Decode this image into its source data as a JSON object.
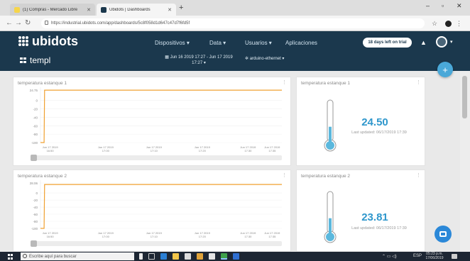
{
  "browser": {
    "tabs": [
      {
        "label": "(1) Compras - Mercado Libre",
        "favicon_color": "#f6d54a"
      },
      {
        "label": "Ubidots | Dashboards",
        "favicon_color": "#1b384d"
      }
    ],
    "new_tab": "+",
    "address": "https://industrial.ubidots.com/app/dashboards/5c8f058d1d647c47d7f6fd5f",
    "window_controls": {
      "minimize": "–",
      "maximize": "▫",
      "close": "✕"
    }
  },
  "app": {
    "logo_text": "ubidots",
    "nav": [
      {
        "label": "Dispositivos ▾"
      },
      {
        "label": "Data ▾"
      },
      {
        "label": "Usuarios ▾"
      },
      {
        "label": "Aplicaciones"
      }
    ],
    "trial_badge": "18 days left on trial",
    "dashboard_name": "templ",
    "date_range": "Jun 16 2019 17:27 - Jun 17 2019 17:27 ▾",
    "device_filter": "arduino-ethernet ▾",
    "fab": "+"
  },
  "widgets": {
    "chart1": {
      "title": "temperatura estanque 1",
      "menu": "⋮",
      "y_ticks": [
        "24.75",
        "0",
        "-20",
        "-40",
        "-60",
        "-80",
        "-100"
      ],
      "x_ticks": [
        [
          "Jun 17 2019",
          "16:50"
        ],
        [
          "Jun 17 2019",
          "17:00"
        ],
        [
          "Jun 17 2019",
          "17:10"
        ],
        [
          "Jun 17 2019",
          "17:20"
        ],
        [
          "Jun 17 2019",
          "17:30"
        ],
        [
          "Jun 17 2019",
          "17:35"
        ]
      ]
    },
    "gauge1": {
      "title": "temperatura estanque 1",
      "menu": "⋮",
      "value": "24.50",
      "updated": "Last updated: 06/17/2019 17:39",
      "fill_fraction": 0.35
    },
    "chart2": {
      "title": "temperatura estanque 2",
      "menu": "⋮",
      "y_ticks": [
        "28.06",
        "0",
        "-20",
        "-40",
        "-60",
        "-80",
        "-100"
      ],
      "x_ticks": [
        [
          "Jun 17 2019",
          "16:50"
        ],
        [
          "Jun 17 2019",
          "17:00"
        ],
        [
          "Jun 17 2019",
          "17:10"
        ],
        [
          "Jun 17 2019",
          "17:20"
        ],
        [
          "Jun 17 2019",
          "17:30"
        ],
        [
          "Jun 17 2019",
          "17:35"
        ]
      ]
    },
    "gauge2": {
      "title": "temperatura estanque 2",
      "menu": "⋮",
      "value": "23.81",
      "updated": "Last updated: 06/17/2019 17:39",
      "fill_fraction": 0.35
    }
  },
  "chart_data": [
    {
      "type": "line",
      "title": "temperatura estanque 1",
      "ylim": [
        -100,
        24.75
      ],
      "x": [
        "16:50",
        "16:52",
        "16:53",
        "17:00",
        "17:10",
        "17:20",
        "17:30",
        "17:35"
      ],
      "series": [
        {
          "values": [
            -100,
            -100,
            24.5,
            24.5,
            24.5,
            24.5,
            24.5,
            24.5
          ]
        }
      ],
      "color": "#f0a030"
    },
    {
      "type": "line",
      "title": "temperatura estanque 2",
      "ylim": [
        -100,
        28.06
      ],
      "x": [
        "16:50",
        "16:52",
        "16:53",
        "17:00",
        "17:10",
        "17:20",
        "17:30",
        "17:35"
      ],
      "series": [
        {
          "values": [
            -100,
            -100,
            23.8,
            23.8,
            23.8,
            23.8,
            23.8,
            23.8
          ]
        }
      ],
      "color": "#f0a030"
    }
  ],
  "taskbar": {
    "search_placeholder": "Escribe aquí para buscar",
    "tray_lang": "ESP",
    "clock_time": "05:23 p.m.",
    "clock_date": "17/06/2019"
  },
  "colors": {
    "header": "#1b384d",
    "accent": "#2f97cc",
    "line": "#f0a030",
    "thermo_fill": "#5bb8dd"
  }
}
